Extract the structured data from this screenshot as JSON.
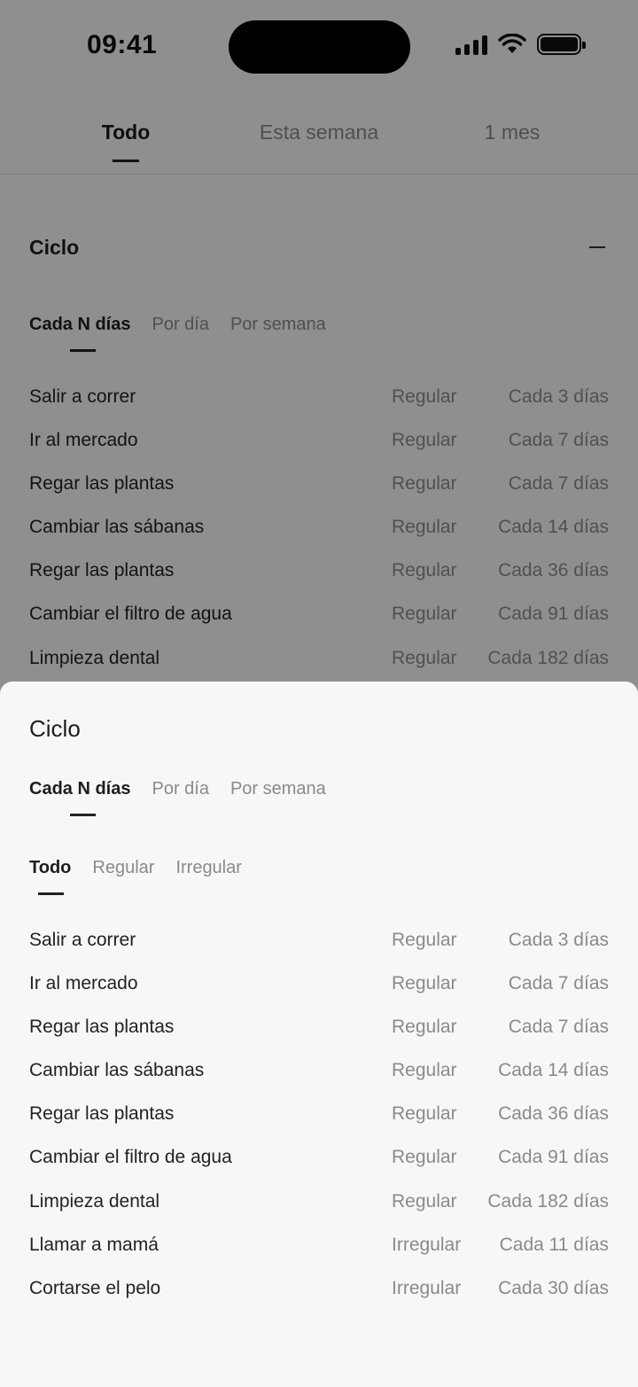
{
  "status_bar": {
    "time": "09:41"
  },
  "top_tabs": [
    {
      "label": "Todo",
      "active": true
    },
    {
      "label": "Esta semana",
      "active": false
    },
    {
      "label": "1 mes",
      "active": false
    }
  ],
  "section": {
    "title": "Ciclo"
  },
  "cycle_tabs": [
    {
      "label": "Cada N días",
      "active": true
    },
    {
      "label": "Por día",
      "active": false
    },
    {
      "label": "Por semana",
      "active": false
    }
  ],
  "background_list": [
    {
      "name": "Salir a correr",
      "type": "Regular",
      "freq": "Cada 3 días"
    },
    {
      "name": "Ir al mercado",
      "type": "Regular",
      "freq": "Cada 7 días"
    },
    {
      "name": "Regar las plantas",
      "type": "Regular",
      "freq": "Cada 7 días"
    },
    {
      "name": "Cambiar las sábanas",
      "type": "Regular",
      "freq": "Cada 14 días"
    },
    {
      "name": "Regar las plantas",
      "type": "Regular",
      "freq": "Cada 36 días"
    },
    {
      "name": "Cambiar el filtro de agua",
      "type": "Regular",
      "freq": "Cada 91 días"
    },
    {
      "name": "Limpieza dental",
      "type": "Regular",
      "freq": "Cada 182 días"
    }
  ],
  "sheet": {
    "title": "Ciclo",
    "cycle_tabs": [
      {
        "label": "Cada N días",
        "active": true
      },
      {
        "label": "Por día",
        "active": false
      },
      {
        "label": "Por semana",
        "active": false
      }
    ],
    "filter_tabs": [
      {
        "label": "Todo",
        "active": true
      },
      {
        "label": "Regular",
        "active": false
      },
      {
        "label": "Irregular",
        "active": false
      }
    ],
    "list": [
      {
        "name": "Salir a correr",
        "type": "Regular",
        "freq": "Cada 3 días"
      },
      {
        "name": "Ir al mercado",
        "type": "Regular",
        "freq": "Cada 7 días"
      },
      {
        "name": "Regar las plantas",
        "type": "Regular",
        "freq": "Cada 7 días"
      },
      {
        "name": "Cambiar las sábanas",
        "type": "Regular",
        "freq": "Cada 14 días"
      },
      {
        "name": "Regar las plantas",
        "type": "Regular",
        "freq": "Cada 36 días"
      },
      {
        "name": "Cambiar el filtro de agua",
        "type": "Regular",
        "freq": "Cada 91 días"
      },
      {
        "name": "Limpieza dental",
        "type": "Regular",
        "freq": "Cada 182 días"
      },
      {
        "name": "Llamar a mamá",
        "type": "Irregular",
        "freq": "Cada 11 días"
      },
      {
        "name": "Cortarse el pelo",
        "type": "Irregular",
        "freq": "Cada 30 días"
      }
    ]
  },
  "icons": {
    "collapse": "minus-icon",
    "signal": "cellular-signal-icon",
    "wifi": "wifi-icon",
    "battery": "battery-icon"
  }
}
